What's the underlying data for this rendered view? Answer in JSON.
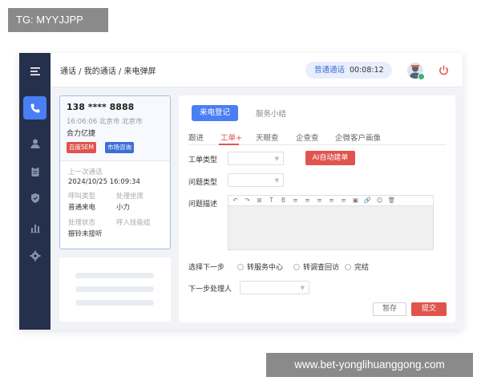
{
  "watermark_top": "TG: MYYJJPP",
  "watermark_bottom": "www.bet-yonglihuanggong.com",
  "sidebar": {
    "items": [
      {
        "name": "phone",
        "active": true
      },
      {
        "name": "user",
        "active": false
      },
      {
        "name": "clipboard",
        "active": false
      },
      {
        "name": "shield",
        "active": false
      },
      {
        "name": "chart",
        "active": false
      },
      {
        "name": "settings",
        "active": false
      }
    ]
  },
  "header": {
    "breadcrumb": "通话 / 我的通话 / 来电弹屏",
    "call_type": "普通通话",
    "call_timer": "00:08:12",
    "status_color": "#3cb371"
  },
  "caller": {
    "phone": "138 **** 8888",
    "time_location": "16:06:06  北京市 北京市",
    "company": "合力亿捷",
    "tags": [
      "百度SEM",
      "市场咨询"
    ],
    "last_call_label": "上一次通话",
    "last_call_value": "2024/10/25  16:09:34",
    "call_type_label": "呼叫类型",
    "call_type_value": "普通来电",
    "agent_label": "处理坐席",
    "agent_value": "小力",
    "status_label": "处理状态",
    "status_value": "振铃未接听",
    "skill_group_label": "呼入技能组",
    "skill_group_value": ""
  },
  "main": {
    "segments": {
      "active": "来电登记",
      "inactive": "服务小结"
    },
    "tabs": [
      "跟进",
      "工单+",
      "天眼查",
      "企查查",
      "企微客户画像"
    ],
    "active_tab": 1,
    "ticket_type_label": "工单类型",
    "ticket_type_value": "",
    "issue_type_label": "问题类型",
    "issue_type_value": "",
    "ai_button": "AI自动建单",
    "issue_desc_label": "问题描述",
    "editor_tools": [
      "↶",
      "↷",
      "⊞",
      "T",
      "B",
      "≡",
      "≡",
      "≡",
      "≡",
      "≡",
      "▣",
      "🔗",
      "☺",
      "🗑"
    ],
    "next_step_label": "选择下一步",
    "next_step_options": [
      "转服务中心",
      "转调查回访",
      "完结"
    ],
    "next_handler_label": "下一步处理人",
    "next_handler_value": "",
    "save_label": "暂存",
    "submit_label": "提交"
  },
  "colors": {
    "accent": "#4a7ef5",
    "danger": "#e0544e",
    "sidebar": "#25304d"
  }
}
